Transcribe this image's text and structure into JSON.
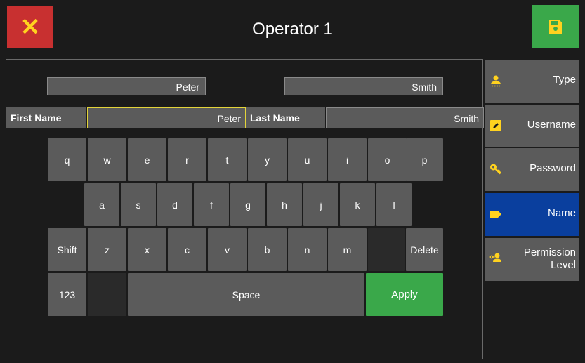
{
  "header": {
    "title": "Operator 1",
    "close_glyph": "✕"
  },
  "preview": {
    "first": "Peter",
    "last": "Smith"
  },
  "fields": {
    "first_label": "First Name",
    "first_value": "Peter",
    "last_label": "Last Name",
    "last_value": "Smith"
  },
  "keyboard": {
    "row1": [
      "q",
      "w",
      "e",
      "r",
      "t",
      "y",
      "u",
      "i",
      "o",
      "p"
    ],
    "row2": [
      "a",
      "s",
      "d",
      "f",
      "g",
      "h",
      "j",
      "k",
      "l"
    ],
    "row3": [
      "z",
      "x",
      "c",
      "v",
      "b",
      "n",
      "m"
    ],
    "shift": "Shift",
    "delete": "Delete",
    "numeric": "123",
    "space": "Space",
    "apply": "Apply"
  },
  "sidebar": {
    "items": [
      {
        "label": "Type",
        "icon": "user-icon"
      },
      {
        "label": "Username",
        "icon": "edit-icon"
      },
      {
        "label": "Password",
        "icon": "key-icon"
      },
      {
        "label": "Name",
        "icon": "tag-icon",
        "active": true
      },
      {
        "label": "Permission Level",
        "icon": "user-permission-icon"
      }
    ]
  },
  "colors": {
    "accent": "#ffd21f",
    "apply": "#3aa84a",
    "close": "#c83030",
    "active": "#0a3f9e",
    "key": "#5b5b5b"
  }
}
